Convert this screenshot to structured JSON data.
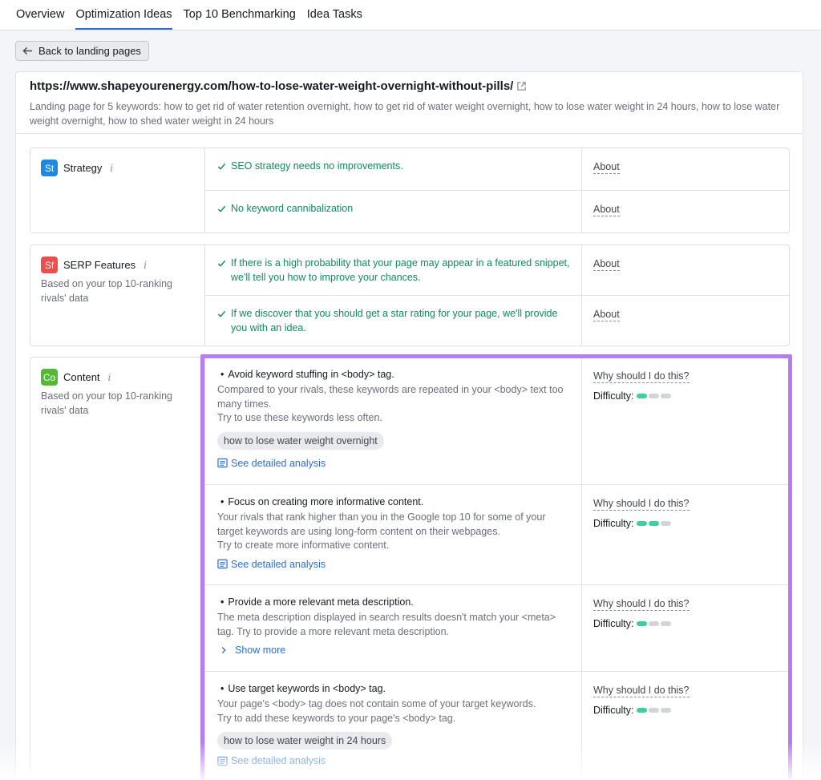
{
  "tabs": [
    {
      "label": "Overview",
      "active": false
    },
    {
      "label": "Optimization Ideas",
      "active": true
    },
    {
      "label": "Top 10 Benchmarking",
      "active": false
    },
    {
      "label": "Idea Tasks",
      "active": false
    }
  ],
  "back_button": "Back to landing pages",
  "page": {
    "url": "https://www.shapeyourenergy.com/how-to-lose-water-weight-overnight-without-pills/",
    "description": "Landing page for 5 keywords: how to get rid of water retention overnight, how to get rid of water weight overnight, how to lose water weight in 24 hours, how to lose water weight overnight, how to shed water weight in 24 hours"
  },
  "strategy": {
    "badge": "St",
    "badge_color": "#1e88e5",
    "title": "Strategy",
    "rows": [
      {
        "text": "SEO strategy needs no improvements.",
        "link": "About"
      },
      {
        "text": "No keyword cannibalization",
        "link": "About"
      }
    ]
  },
  "serp": {
    "badge": "Sf",
    "badge_color": "#ef4d4d",
    "title": "SERP Features",
    "subtitle": "Based on your top 10-ranking rivals' data",
    "rows": [
      {
        "text": "If there is a high probability that your page may appear in a featured snippet, we'll tell you how to improve your chances.",
        "link": "About"
      },
      {
        "text": "If we discover that you should get a star rating for your page, we'll provide you with an idea.",
        "link": "About"
      }
    ]
  },
  "content": {
    "badge": "Co",
    "badge_color": "#54b836",
    "title": "Content",
    "subtitle": "Based on your top 10-ranking rivals' data",
    "ideas": [
      {
        "title": "Avoid keyword stuffing in <body> tag.",
        "body": "Compared to your rivals, these keywords are repeated in your <body> text too many times.",
        "body2": "Try to use these keywords less often.",
        "chip": "how to lose water weight overnight",
        "link": "See detailed analysis",
        "why": "Why should I do this?",
        "difficulty_label": "Difficulty:",
        "difficulty": 1
      },
      {
        "title": "Focus on creating more informative content.",
        "body": "Your rivals that rank higher than you in the Google top 10 for some of your target keywords are using long-form content on their webpages.",
        "body2": "Try to create more informative content.",
        "link": "See detailed analysis",
        "why": "Why should I do this?",
        "difficulty_label": "Difficulty:",
        "difficulty": 2
      },
      {
        "title": "Provide a more relevant meta description.",
        "body": "The meta description displayed in search results doesn't match your <meta> tag. Try to provide a more relevant meta description.",
        "link": "Show more",
        "why": "Why should I do this?",
        "difficulty_label": "Difficulty:",
        "difficulty": 1
      },
      {
        "title": "Use target keywords in <body> tag.",
        "body": "Your page's <body> tag does not contain some of your target keywords.",
        "body2": "Try to add these keywords to your page's <body> tag.",
        "chip": "how to lose water weight in 24 hours",
        "link": "See detailed analysis",
        "why": "Why should I do this?",
        "difficulty_label": "Difficulty:",
        "difficulty": 1
      }
    ]
  },
  "colors": {
    "accent": "#2b6fd6",
    "success": "#0f8a5f",
    "highlight": "#b57df0",
    "difficulty_on": "#3ecf9a"
  }
}
